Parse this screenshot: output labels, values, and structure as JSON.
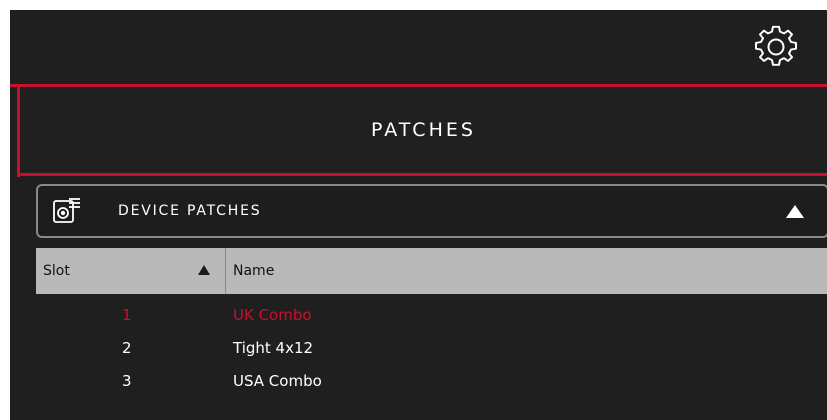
{
  "colors": {
    "accent": "#c8102e",
    "background": "#1f1f1f",
    "text": "#ffffff",
    "header_bg": "#b9b9b9"
  },
  "topbar": {
    "settings_icon": "gear-icon"
  },
  "header": {
    "title": "PATCHES"
  },
  "dropdown": {
    "label": "DEVICE PATCHES",
    "icon": "device-patches-icon",
    "state": "expanded"
  },
  "table": {
    "columns": [
      "Slot",
      "Name"
    ],
    "sort_column": "Slot",
    "sort_direction": "ascending",
    "rows": [
      {
        "slot": "1",
        "name": "UK Combo",
        "selected": true
      },
      {
        "slot": "2",
        "name": "Tight 4x12",
        "selected": false
      },
      {
        "slot": "3",
        "name": "USA Combo",
        "selected": false
      }
    ]
  }
}
